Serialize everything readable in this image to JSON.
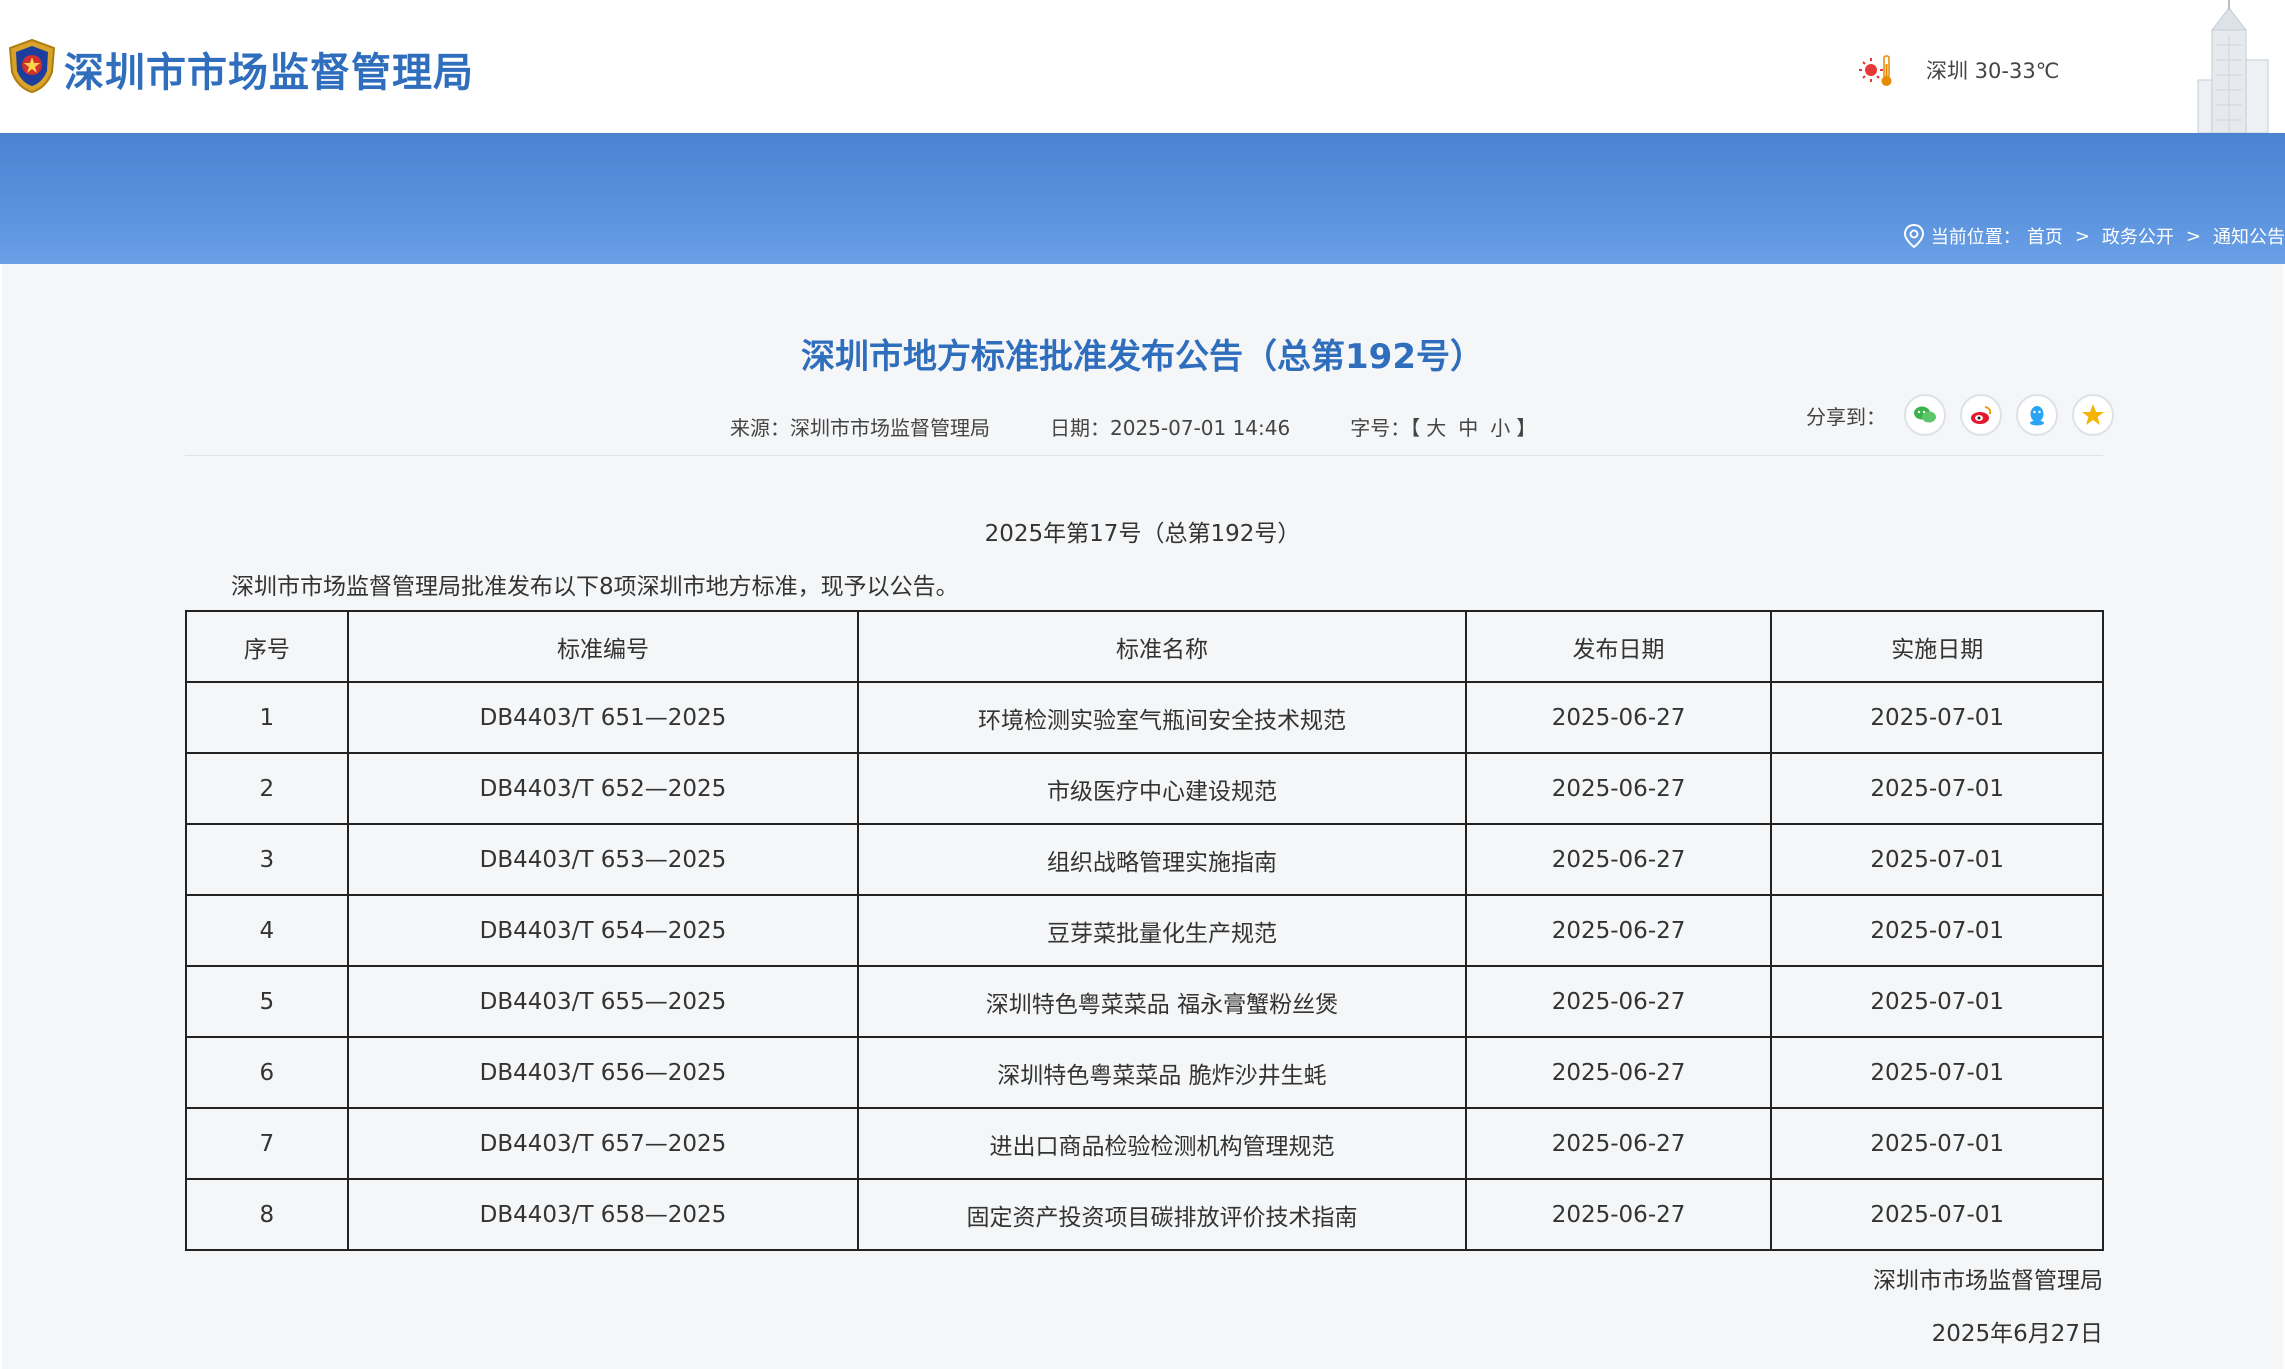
{
  "header": {
    "site_title": "深圳市市场监督管理局",
    "weather": "深圳 30-33℃"
  },
  "breadcrumb": {
    "prefix": "当前位置：",
    "items": [
      "首页",
      "政务公开",
      "通知公告"
    ],
    "separator": ">"
  },
  "article": {
    "title": "深圳市地方标准批准发布公告（总第192号）",
    "source": "来源：深圳市市场监督管理局",
    "date": "日期：2025-07-01 14:46",
    "font_size_label": "字号：",
    "font_size_open": "【",
    "font_sizes": [
      "大",
      "中",
      "小"
    ],
    "font_size_close": "】",
    "share_label": "分享到：",
    "share_icons": [
      "wechat-icon",
      "weibo-icon",
      "qq-icon",
      "qzone-icon"
    ],
    "issue": "2025年第17号（总第192号）",
    "intro": "深圳市市场监督管理局批准发布以下8项深圳市地方标准，现予以公告。",
    "table": {
      "headers": [
        "序号",
        "标准编号",
        "标准名称",
        "发布日期",
        "实施日期"
      ],
      "rows": [
        [
          "1",
          "DB4403/T 651—2025",
          "环境检测实验室气瓶间安全技术规范",
          "2025-06-27",
          "2025-07-01"
        ],
        [
          "2",
          "DB4403/T 652—2025",
          "市级医疗中心建设规范",
          "2025-06-27",
          "2025-07-01"
        ],
        [
          "3",
          "DB4403/T 653—2025",
          "组织战略管理实施指南",
          "2025-06-27",
          "2025-07-01"
        ],
        [
          "4",
          "DB4403/T 654—2025",
          "豆芽菜批量化生产规范",
          "2025-06-27",
          "2025-07-01"
        ],
        [
          "5",
          "DB4403/T 655—2025",
          "深圳特色粤菜菜品 福永膏蟹粉丝煲",
          "2025-06-27",
          "2025-07-01"
        ],
        [
          "6",
          "DB4403/T 656—2025",
          "深圳特色粤菜菜品 脆炸沙井生蚝",
          "2025-06-27",
          "2025-07-01"
        ],
        [
          "7",
          "DB4403/T 657—2025",
          "进出口商品检验检测机构管理规范",
          "2025-06-27",
          "2025-07-01"
        ],
        [
          "8",
          "DB4403/T 658—2025",
          "固定资产投资项目碳排放评价技术指南",
          "2025-06-27",
          "2025-07-01"
        ]
      ]
    },
    "signature_org": "深圳市市场监督管理局",
    "signature_date": "2025年6月27日"
  },
  "colors": {
    "brand_blue": "#2f6dbd",
    "banner_blue": "#4b83d1",
    "panel_bg": "#f5f6f7"
  }
}
